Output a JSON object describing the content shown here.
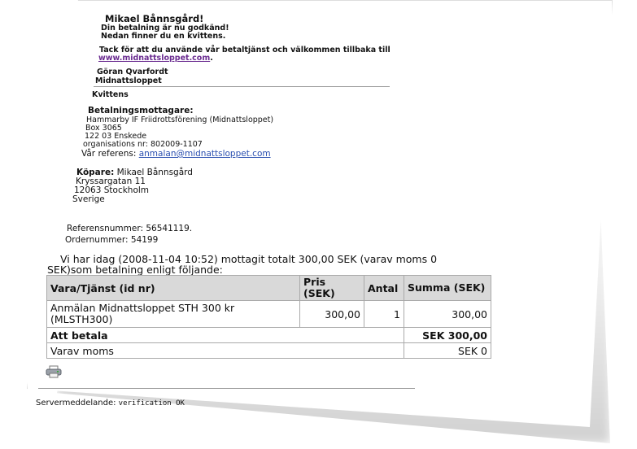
{
  "greeting": {
    "name": "Mikael Bånnsgård!",
    "line1": "Din betalning är nu godkänd!",
    "line2": "Nedan finner du en kvittens."
  },
  "thanks": {
    "text": "Tack för att du använde vår betaltjänst och välkommen tillbaka till",
    "link": "www.midnattsloppet.com",
    "link_suffix": "."
  },
  "signature": {
    "name": "Göran Qvarfordt",
    "org": "Midnattsloppet"
  },
  "receipt_title": "Kvittens",
  "recipient": {
    "heading": "Betalningsmottagare:",
    "lines": [
      "Hammarby IF Friidrottsförening (Midnattsloppet)",
      "Box 3065",
      "122 03 Enskede",
      "organisations nr: 802009-1107"
    ],
    "ref_label": "Vår referens:",
    "ref_email": "anmalan@midnattsloppet.com"
  },
  "buyer": {
    "label": "Köpare:",
    "name": "Mikael Bånnsgård",
    "lines": [
      "Kryssargatan 11",
      "12063 Stockholm",
      "Sverige"
    ]
  },
  "numbers": {
    "reference": "Referensnummer: 56541119.",
    "order": "Ordernummer: 54199"
  },
  "intro": {
    "line1": "Vi har idag (2008-11-04 10:52) mottagit totalt 300,00 SEK (varav moms 0",
    "line2": "SEK)som betalning enligt följande:"
  },
  "table": {
    "headers": {
      "item": "Vara/Tjänst (id nr)",
      "price": "Pris (SEK)",
      "qty": "Antal",
      "sum": "Summa (SEK)"
    },
    "rows": [
      {
        "item": "Anmälan Midnattsloppet STH 300 kr (MLSTH300)",
        "price": "300,00",
        "qty": "1",
        "sum": "300,00"
      }
    ],
    "total_label": "Att betala",
    "total_value": "SEK 300,00",
    "vat_label": "Varav moms",
    "vat_value": "SEK 0"
  },
  "server": {
    "label": "Servermeddelande:",
    "message": "verification OK"
  }
}
